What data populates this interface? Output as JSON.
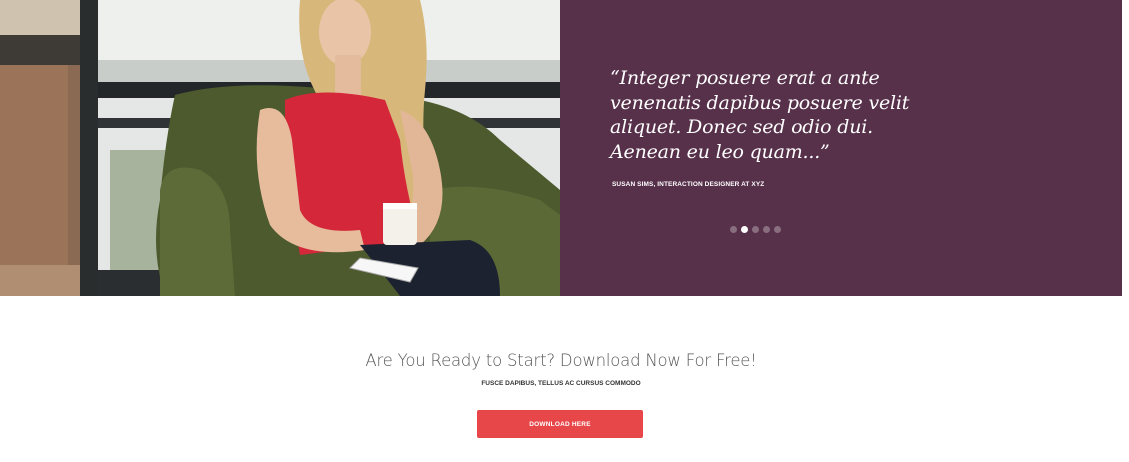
{
  "testimonial": {
    "quote": "“Integer posuere erat a ante venenatis dapibus posuere velit aliquet. Donec sed odio dui. Aenean eu leo quam...”",
    "author": "SUSAN SIMS, INTERACTION DESIGNER AT XYZ",
    "slider": {
      "count": 5,
      "active_index": 1
    },
    "photo_icon": "woman-in-armchair-photo",
    "panel_color": "#57304a"
  },
  "cta": {
    "title": "Are You Ready to Start? Download Now For Free!",
    "subtitle": "FUSCE DAPIBUS, TELLUS AC CURSUS COMMODO",
    "button_label": "DOWNLOAD HERE",
    "button_color": "#e8474a"
  }
}
